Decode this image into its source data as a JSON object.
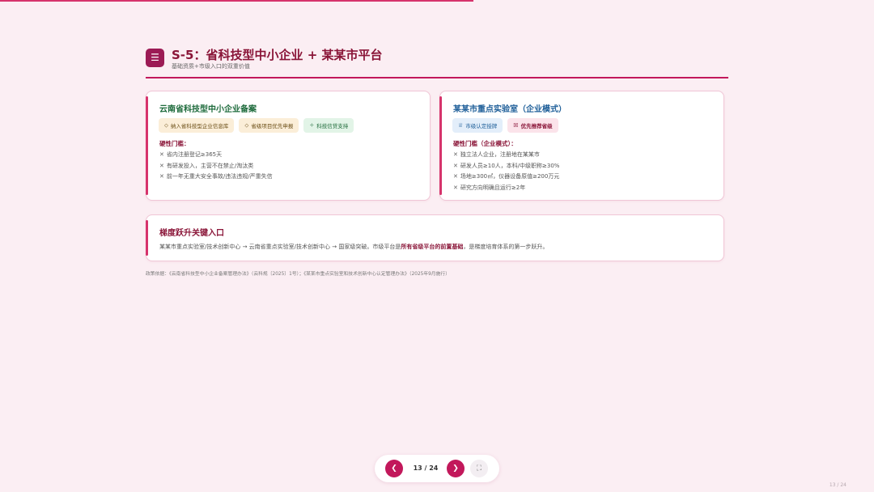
{
  "progress": {
    "current": 13,
    "total": 24,
    "fraction": 0.5417,
    "color": "#d6336c"
  },
  "header": {
    "icon": "menu-icon",
    "icon_glyph": "☰",
    "title": "S-5：省科技型中小企业 + 某某市平台",
    "subtitle": "基础资质+市级入口的双重价值"
  },
  "cards": {
    "left": {
      "title": "云南省科技型中小企业备案",
      "tags": [
        {
          "icon": "tag-icon",
          "glyph": "⬦",
          "label": "纳入省科技型企业信息库"
        },
        {
          "icon": "tag-icon",
          "glyph": "⬦",
          "label": "省级项目优先申报"
        },
        {
          "icon": "money-icon",
          "glyph": "✧",
          "label": "科技信贷支持"
        }
      ],
      "req_title": "硬性门槛：",
      "requirements": [
        "省内注册登记≥365天",
        "有研发投入，主营不在禁止/淘汰类",
        "前一年无重大安全事故/违法违规/严重失信"
      ]
    },
    "right": {
      "title": "某某市重点实验室（企业模式）",
      "tags": [
        {
          "icon": "trophy-icon",
          "glyph": "♕",
          "label": "市级认定授牌"
        },
        {
          "icon": "priority-icon",
          "glyph": "☒",
          "label": "优先推荐省级"
        }
      ],
      "req_title": "硬性门槛（企业模式）：",
      "requirements": [
        "独立法人企业，注册地在某某市",
        "研发人员≥10人，本科/中级职称≥30%",
        "场地≥300㎡，仪器设备原值≥200万元",
        "研究方向明确且运行≥2年"
      ]
    },
    "bottom": {
      "title": "梯度跃升关键入口",
      "text_before": "某某市重点实验室/技术创新中心 → 云南省重点实验室/技术创新中心 → 国家级突破。市级平台是",
      "text_bold": "所有省级平台的前置基础",
      "text_after": "，是梯度培育体系的第一步跃升。"
    }
  },
  "source": "政策依据：《云南省科技型中小企业备案管理办法》（云科规〔2025〕1号）；《某某市重点实验室和技术创新中心认定管理办法》（2025年9月施行）",
  "nav": {
    "prev_glyph": "❮",
    "next_glyph": "❯",
    "fullscreen_glyph": "⛶",
    "counter": "13 / 24"
  },
  "corner_counter": "13 / 24",
  "x_glyph": "✕"
}
